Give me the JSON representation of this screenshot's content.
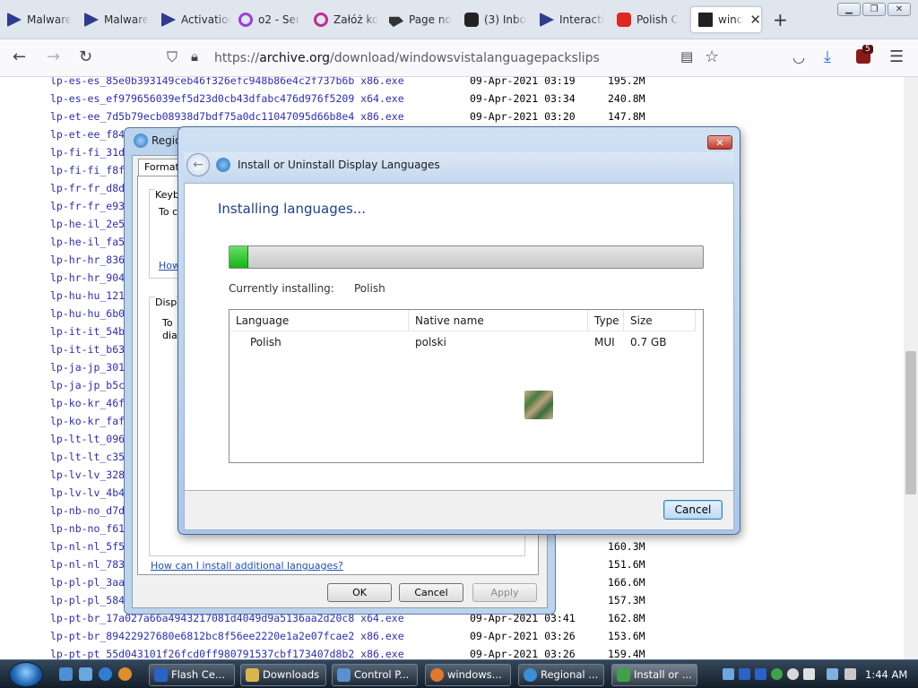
{
  "browser": {
    "tabs": [
      {
        "label": "Malware",
        "icon": "malwarebytes-icon"
      },
      {
        "label": "Malware",
        "icon": "malwarebytes-icon"
      },
      {
        "label": "Activation",
        "icon": "devices-icon"
      },
      {
        "label": "o2 - Ser",
        "icon": "o2-icon"
      },
      {
        "label": "Załóż ko",
        "icon": "zaloz-icon"
      },
      {
        "label": "Page no",
        "icon": "page-icon"
      },
      {
        "label": "(3) Inbo",
        "icon": "inbox-icon"
      },
      {
        "label": "Interacti",
        "icon": "devices-icon"
      },
      {
        "label": "Polish C",
        "icon": "youtube-icon"
      },
      {
        "label": "windo",
        "icon": "archive-icon",
        "active": true
      }
    ],
    "new_tab": "+",
    "url_scheme": "https://",
    "url_host": "archive.org",
    "url_path": "/download/windowsvistalanguagepackslips",
    "extension_badge": "5"
  },
  "files": [
    {
      "name": "lp-es-es_85e0b393149ceb46f326efc948b86e4c2f737b6b x86.exe",
      "date": "09-Apr-2021 03:19",
      "size": "195.2M"
    },
    {
      "name": "lp-es-es_ef979656039ef5d23d0cb43dfabc476d976f5209 x64.exe",
      "date": "09-Apr-2021 03:34",
      "size": "240.8M"
    },
    {
      "name": "lp-et-ee_7d5b79ecb08938d7bdf75a0dc11047095d66b8e4 x86.exe",
      "date": "09-Apr-2021 03:20",
      "size": "147.8M"
    },
    {
      "name": "lp-et-ee_f84",
      "date": "",
      "size": ""
    },
    {
      "name": "lp-fi-fi_31d",
      "date": "",
      "size": ""
    },
    {
      "name": "lp-fi-fi_f8f",
      "date": "",
      "size": ""
    },
    {
      "name": "lp-fr-fr_d8d",
      "date": "",
      "size": ""
    },
    {
      "name": "lp-fr-fr_e93",
      "date": "",
      "size": ""
    },
    {
      "name": "lp-he-il_2e5",
      "date": "",
      "size": ""
    },
    {
      "name": "lp-he-il_fa5",
      "date": "",
      "size": ""
    },
    {
      "name": "lp-hr-hr_836",
      "date": "",
      "size": ""
    },
    {
      "name": "lp-hr-hr_904",
      "date": "",
      "size": ""
    },
    {
      "name": "lp-hu-hu_121",
      "date": "",
      "size": ""
    },
    {
      "name": "lp-hu-hu_6b0",
      "date": "",
      "size": ""
    },
    {
      "name": "lp-it-it_54b",
      "date": "",
      "size": ""
    },
    {
      "name": "lp-it-it_b63",
      "date": "",
      "size": ""
    },
    {
      "name": "lp-ja-jp_301",
      "date": "",
      "size": ""
    },
    {
      "name": "lp-ja-jp_b5c",
      "date": "",
      "size": ""
    },
    {
      "name": "lp-ko-kr_46f",
      "date": "",
      "size": ""
    },
    {
      "name": "lp-ko-kr_faf",
      "date": "",
      "size": ""
    },
    {
      "name": "lp-lt-lt_096",
      "date": "",
      "size": ""
    },
    {
      "name": "lp-lt-lt_c35",
      "date": "",
      "size": ""
    },
    {
      "name": "lp-lv-lv_328",
      "date": "",
      "size": ""
    },
    {
      "name": "lp-lv-lv_4b4",
      "date": "",
      "size": ""
    },
    {
      "name": "lp-nb-no_d7d",
      "date": "",
      "size": ""
    },
    {
      "name": "lp-nb-no_f61",
      "date": "3:25",
      "size": "156.7M"
    },
    {
      "name": "lp-nl-nl_5f5",
      "date": "3:41",
      "size": "160.3M"
    },
    {
      "name": "lp-nl-nl_783",
      "date": "3:25",
      "size": "151.6M"
    },
    {
      "name": "lp-pl-pl_3aa",
      "date": "3:41",
      "size": "166.6M"
    },
    {
      "name": "lp-pl-pl_584",
      "date": "3:25",
      "size": "157.3M"
    },
    {
      "name": "lp-pt-br_17a027a66a4943217081d4049d9a5136aa2d20c8 x64.exe",
      "date": "09-Apr-2021 03:41",
      "size": "162.8M"
    },
    {
      "name": "lp-pt-br_89422927680e6812bc8f56ee2220e1a2e07fcae2 x86.exe",
      "date": "09-Apr-2021 03:26",
      "size": "153.6M"
    },
    {
      "name": "lp-pt-pt_55d043101f26fcd0ff980791537cbf173407d8b2 x86.exe",
      "date": "09-Apr-2021 03:26",
      "size": "159.4M"
    }
  ],
  "region_dialog": {
    "title": "Regio",
    "tab_formats": "Formats",
    "group1_title": "Keyb",
    "group1_text": "To c",
    "group1_link": "How",
    "group2_title": "Disp",
    "group2_text1": "To",
    "group2_text2": "dia",
    "link_additional": "How can I install additional languages?",
    "ok": "OK",
    "cancel": "Cancel",
    "apply": "Apply"
  },
  "install_dialog": {
    "title": "Install or Uninstall Display Languages",
    "heading": "Installing languages...",
    "progress": 0.04,
    "currently_installing_label": "Currently installing:",
    "currently_installing_value": "Polish",
    "columns": [
      "Language",
      "Native name",
      "Type",
      "Size"
    ],
    "rows": [
      {
        "language": "Polish",
        "native": "polski",
        "type": "MUI",
        "size": "0.7 GB"
      }
    ],
    "cancel": "Cancel",
    "close": "✕"
  },
  "taskbar": {
    "items": [
      {
        "label": "Flash Ce...",
        "icon": "flash-icon"
      },
      {
        "label": "Downloads",
        "icon": "downloads-icon"
      },
      {
        "label": "Control P...",
        "icon": "control-panel-icon"
      },
      {
        "label": "windows...",
        "icon": "firefox-icon"
      },
      {
        "label": "Regional ...",
        "icon": "regional-icon"
      },
      {
        "label": "Install or ...",
        "icon": "install-icon",
        "active": true
      }
    ],
    "clock": "1:44 AM"
  }
}
